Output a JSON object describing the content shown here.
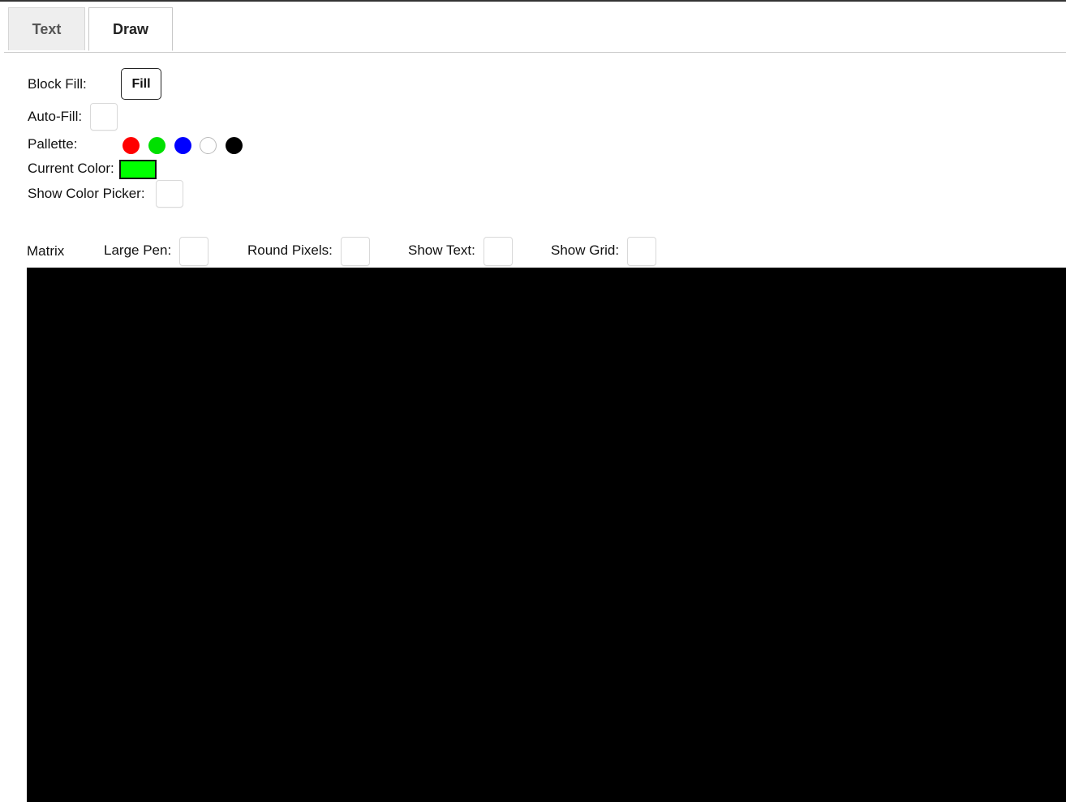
{
  "tabs": [
    {
      "label": "Text",
      "active": false
    },
    {
      "label": "Draw",
      "active": true
    }
  ],
  "controls": {
    "block_fill_label": "Block Fill:",
    "fill_button": "Fill",
    "auto_fill_label": "Auto-Fill:",
    "auto_fill_checked": false,
    "pallette_label": "Pallette:",
    "pallette": [
      "#ff0000",
      "#00e000",
      "#0000ff",
      "#ffffff",
      "#000000"
    ],
    "current_color_label": "Current Color:",
    "current_color": "#00ff00",
    "show_picker_label": "Show Color Picker:",
    "show_picker_checked": false
  },
  "matrix_bar": {
    "title": "Matrix",
    "large_pen_label": "Large Pen:",
    "round_pixels_label": "Round Pixels:",
    "show_text_label": "Show Text:",
    "show_grid_label": "Show Grid:"
  },
  "matrix": {
    "background": "#000000"
  }
}
